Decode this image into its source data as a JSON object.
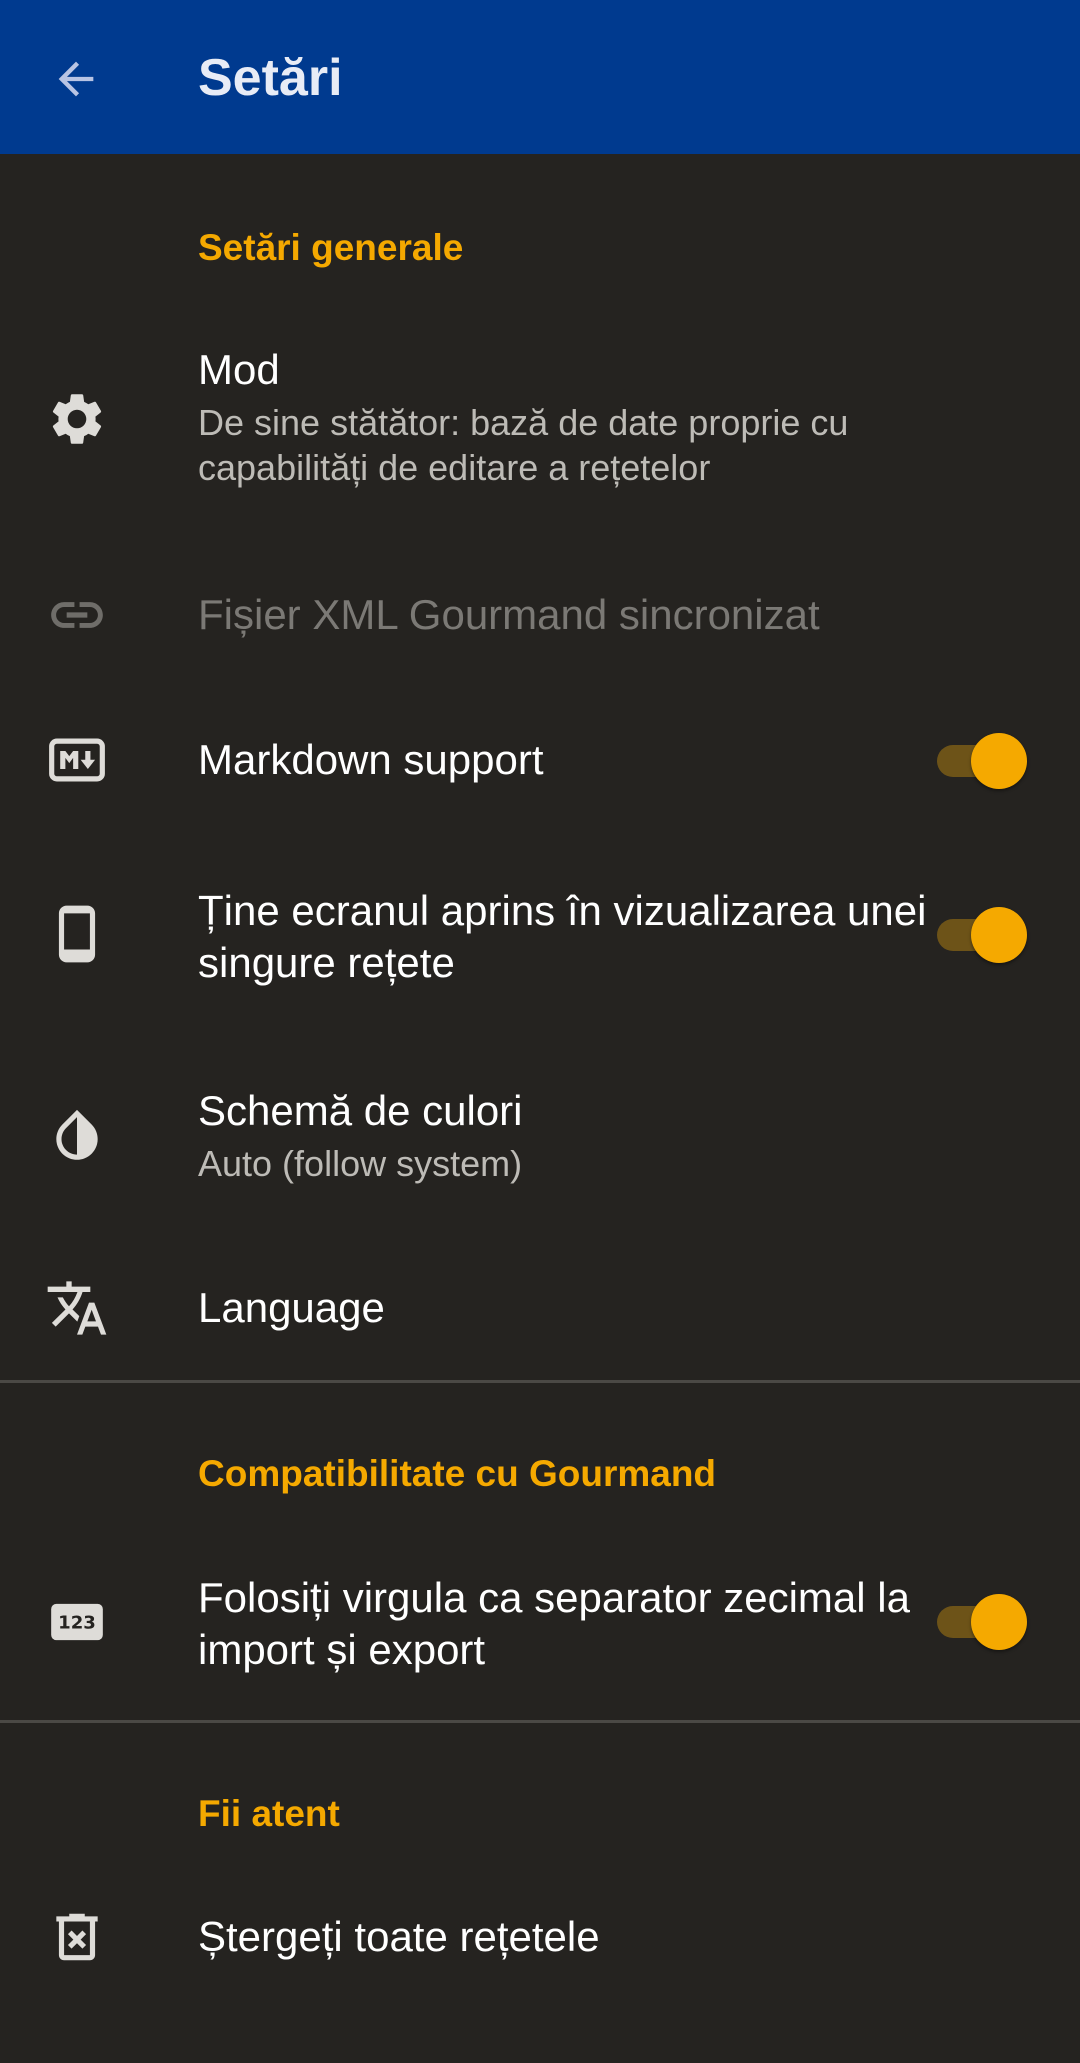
{
  "appbar": {
    "title": "Setări",
    "back_icon": "arrow-back-icon"
  },
  "sections": {
    "general": {
      "header": "Setări generale",
      "mode": {
        "icon": "gear-icon",
        "title": "Mod",
        "subtitle": "De sine stătător: bază de date proprie cu capabilități de editare a rețetelor"
      },
      "synced_file": {
        "icon": "link-icon",
        "title": "Fișier XML Gourmand sincronizat"
      },
      "markdown": {
        "icon": "markdown-icon",
        "title": "Markdown support",
        "enabled": true
      },
      "keep_screen_on": {
        "icon": "phone-icon",
        "title": "Ține ecranul aprins în vizualizarea unei singure rețete",
        "enabled": true
      },
      "color_scheme": {
        "icon": "contrast-drop-icon",
        "title": "Schemă de culori",
        "subtitle": "Auto (follow system)"
      },
      "language": {
        "icon": "translate-icon",
        "title": "Language"
      }
    },
    "compat": {
      "header": "Compatibilitate cu Gourmand",
      "decimal_comma": {
        "icon": "numbers-123-icon",
        "title": "Folosiți virgula ca separator zecimal la import și export",
        "enabled": true
      }
    },
    "danger": {
      "header": "Fii atent",
      "delete_all": {
        "icon": "trash-icon",
        "title": "Ștergeți toate rețetele"
      }
    }
  },
  "colors": {
    "appbar": "#003a8f",
    "background": "#252320",
    "accent": "#f5a900"
  }
}
